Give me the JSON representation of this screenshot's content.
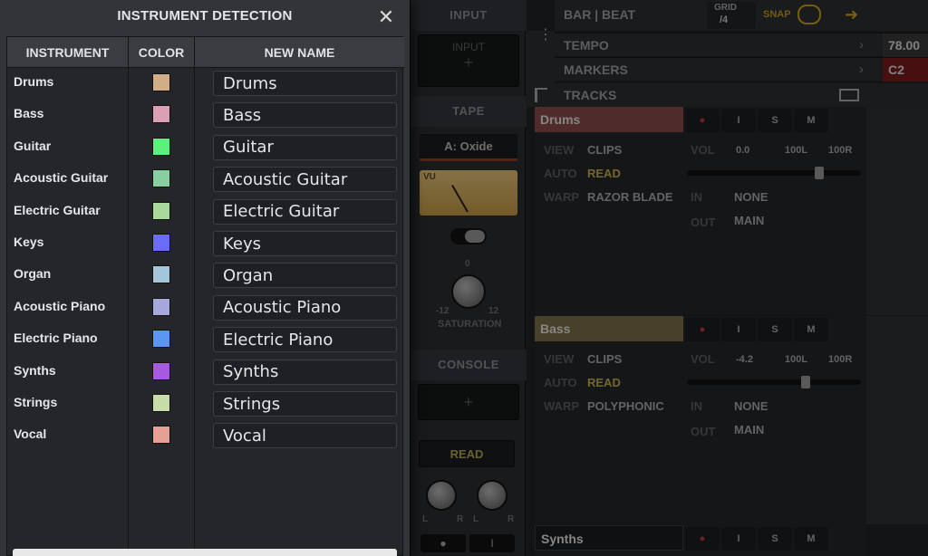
{
  "dialog": {
    "title": "INSTRUMENT DETECTION",
    "close_glyph": "✕",
    "columns": {
      "instrument": "INSTRUMENT",
      "color": "COLOR",
      "new_name": "NEW NAME"
    },
    "rows": [
      {
        "instrument": "Drums",
        "color": "#d2ae88",
        "new_name": "Drums"
      },
      {
        "instrument": "Bass",
        "color": "#dba0b4",
        "new_name": "Bass"
      },
      {
        "instrument": "Guitar",
        "color": "#5df07c",
        "new_name": "Guitar"
      },
      {
        "instrument": "Acoustic Guitar",
        "color": "#86cfa1",
        "new_name": "Acoustic Guitar"
      },
      {
        "instrument": "Electric Guitar",
        "color": "#a8d99a",
        "new_name": "Electric Guitar"
      },
      {
        "instrument": "Keys",
        "color": "#6a6cf5",
        "new_name": "Keys"
      },
      {
        "instrument": "Organ",
        "color": "#a3c6da",
        "new_name": "Organ"
      },
      {
        "instrument": "Acoustic Piano",
        "color": "#a6a8dc",
        "new_name": "Acoustic Piano"
      },
      {
        "instrument": "Electric Piano",
        "color": "#5b96f2",
        "new_name": "Electric Piano"
      },
      {
        "instrument": "Synths",
        "color": "#a65add",
        "new_name": "Synths"
      },
      {
        "instrument": "Strings",
        "color": "#c7dca6",
        "new_name": "Strings"
      },
      {
        "instrument": "Vocal",
        "color": "#e6a095",
        "new_name": "Vocal"
      }
    ]
  },
  "channel_strip": {
    "input_header": "INPUT",
    "input_slot": "INPUT",
    "plus": "+",
    "tape_header": "TAPE",
    "tape_plugin": "A: Oxide",
    "vu_label": "VU",
    "saturation_label": "SATURATION",
    "sat_zero": "0",
    "sat_min": "-12",
    "sat_max": "12",
    "console_header": "CONSOLE",
    "read_label": "READ",
    "pan_l": "L",
    "pan_r": "R",
    "record_glyph": "●",
    "input_glyph": "I"
  },
  "top_bar": {
    "bar_beat": "BAR | BEAT",
    "grid_label": "GRID",
    "grid_value": "/4",
    "snap": "SNAP"
  },
  "rulers": {
    "tempo": {
      "label": "TEMPO",
      "value": "78.00"
    },
    "markers": {
      "label": "MARKERS",
      "value": "C2"
    },
    "tracks": {
      "label": "TRACKS"
    }
  },
  "tracks": [
    {
      "name": "Drums",
      "color": "#8a4a4a",
      "view_label": "VIEW",
      "view": "CLIPS",
      "auto_label": "AUTO",
      "auto": "READ",
      "warp_label": "WARP",
      "warp": "RAZOR BLADE",
      "vol_label": "VOL",
      "vol": "0.0",
      "pan_l": "100L",
      "pan_r": "100R",
      "vol_level": 0.76,
      "in_label": "IN",
      "in": "NONE",
      "out_label": "OUT",
      "out": "MAIN"
    },
    {
      "name": "Bass",
      "color": "#7e6e46",
      "view_label": "VIEW",
      "view": "CLIPS",
      "auto_label": "AUTO",
      "auto": "READ",
      "warp_label": "WARP",
      "warp": "POLYPHONIC",
      "vol_label": "VOL",
      "vol": "-4.2",
      "pan_l": "100L",
      "pan_r": "100R",
      "vol_level": 0.68,
      "in_label": "IN",
      "in": "NONE",
      "out_label": "OUT",
      "out": "MAIN"
    }
  ],
  "track_buttons": {
    "record": "●",
    "input": "I",
    "solo": "S",
    "mute": "M"
  },
  "synths_track": {
    "name": "Synths"
  }
}
